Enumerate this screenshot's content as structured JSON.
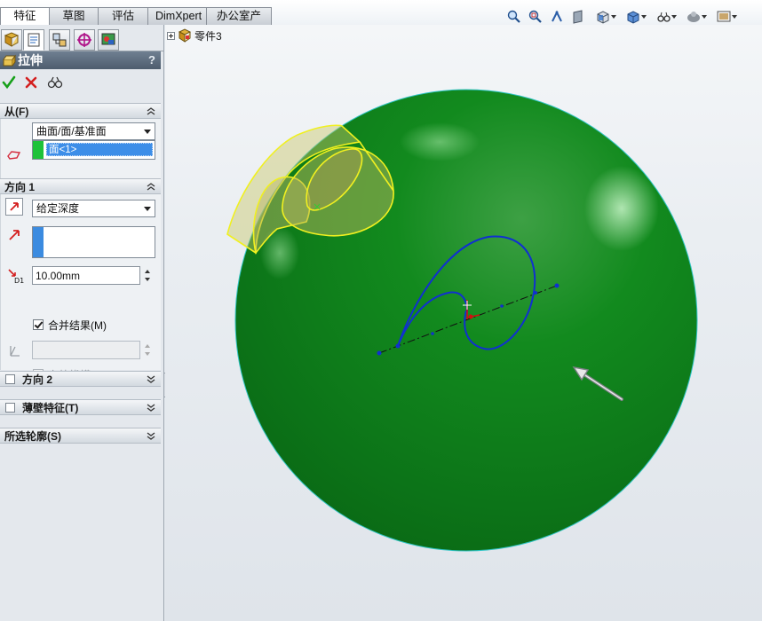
{
  "command_tabs": [
    {
      "label": "特征",
      "active": true
    },
    {
      "label": "草图",
      "active": false
    },
    {
      "label": "评估",
      "active": false
    },
    {
      "label": "DimXpert",
      "active": false
    },
    {
      "label": "办公室产品",
      "active": false
    }
  ],
  "view_toolbar": {
    "icons": [
      "zoom-to-fit-icon",
      "zoom-area-icon",
      "previous-view-icon",
      "section-view-icon",
      "view-orientation-icon",
      "display-style-icon",
      "hide-show-icon",
      "edit-appearance-icon",
      "apply-scene-icon"
    ]
  },
  "panel_tabs": [
    "featuremanager-tab",
    "propertymanager-tab",
    "configurationmanager-tab",
    "dimxpert-manager-tab",
    "display-manager-tab"
  ],
  "property_manager": {
    "title": "拉伸",
    "help": "?",
    "from": {
      "header": "从(F)",
      "start_condition": "曲面/面/基准面",
      "selection": "面<1>",
      "selection_color": "#1ec23a"
    },
    "direction1": {
      "header": "方向 1",
      "end_condition": "给定深度",
      "direction_color": "#3b8be0",
      "depth": "10.00mm",
      "depth_label": "D1",
      "merge_result_label": "合并结果(M)",
      "merge_result_checked": true,
      "draft_outward_label": "向外拔模(O)",
      "draft_outward_checked": false
    },
    "direction2": {
      "header": "方向 2",
      "checked": false
    },
    "thin_feature": {
      "header": "薄壁特征(T)",
      "checked": false
    },
    "selected_contours": {
      "header": "所选轮廓(S)"
    }
  },
  "tree_root_label": "零件3",
  "colors": {
    "sphere": "#0f7c1a",
    "sketch": "#1030d0",
    "preview": "#f0f020",
    "accent": "#3b8be0"
  }
}
